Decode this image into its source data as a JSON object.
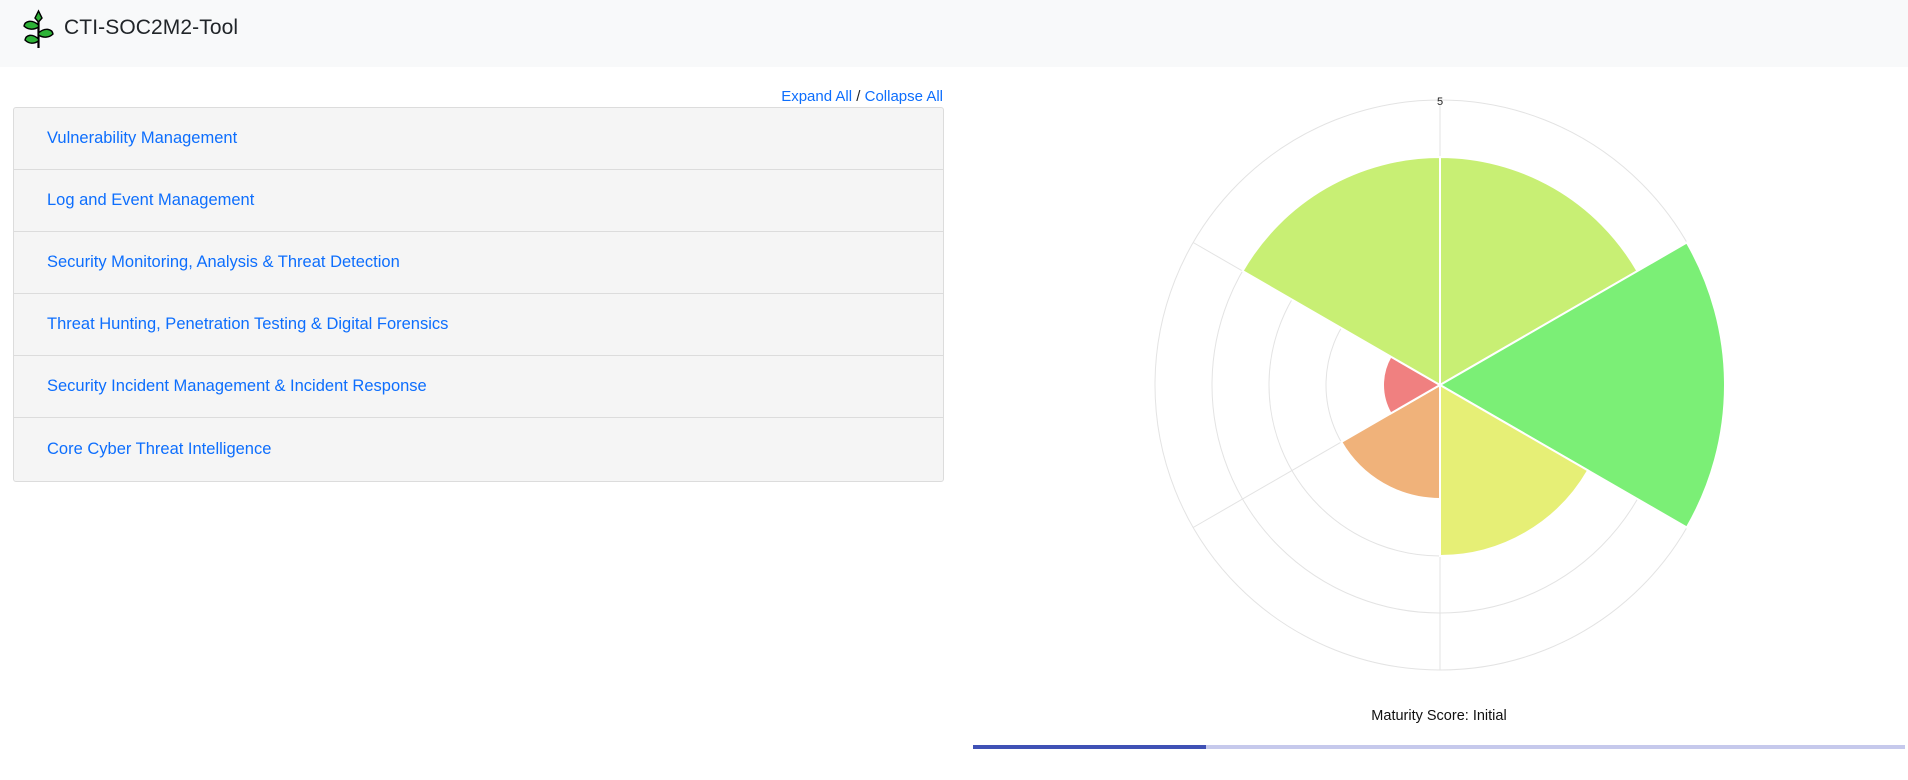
{
  "app": {
    "title": "CTI-SOC2M2-Tool",
    "logo_icon": "leaf-sprout-icon"
  },
  "toolbar": {
    "expand_label": "Expand All",
    "separator": " / ",
    "collapse_label": "Collapse All"
  },
  "sections": [
    {
      "label": "Vulnerability Management"
    },
    {
      "label": "Log and Event Management"
    },
    {
      "label": "Security Monitoring, Analysis & Threat Detection"
    },
    {
      "label": "Threat Hunting, Penetration Testing & Digital Forensics"
    },
    {
      "label": "Security Incident Management & Incident Response"
    },
    {
      "label": "Core Cyber Threat Intelligence"
    }
  ],
  "chart_data": {
    "type": "polar_area",
    "rmax": 5,
    "ticks": [
      1,
      2,
      3,
      4,
      5
    ],
    "tick_labels_visible": [
      "5"
    ],
    "grid": true,
    "values": [
      4.0,
      5.0,
      3.0,
      2.0,
      1.0,
      4.0
    ],
    "colors": [
      "#c8ef74",
      "#7bef76",
      "#e6ef76",
      "#f0b27a",
      "#f08080",
      "#c8ef74"
    ]
  },
  "footer": {
    "maturity_label": "Maturity Score: ",
    "maturity_value": "Initial",
    "progress_fraction": 0.25
  }
}
